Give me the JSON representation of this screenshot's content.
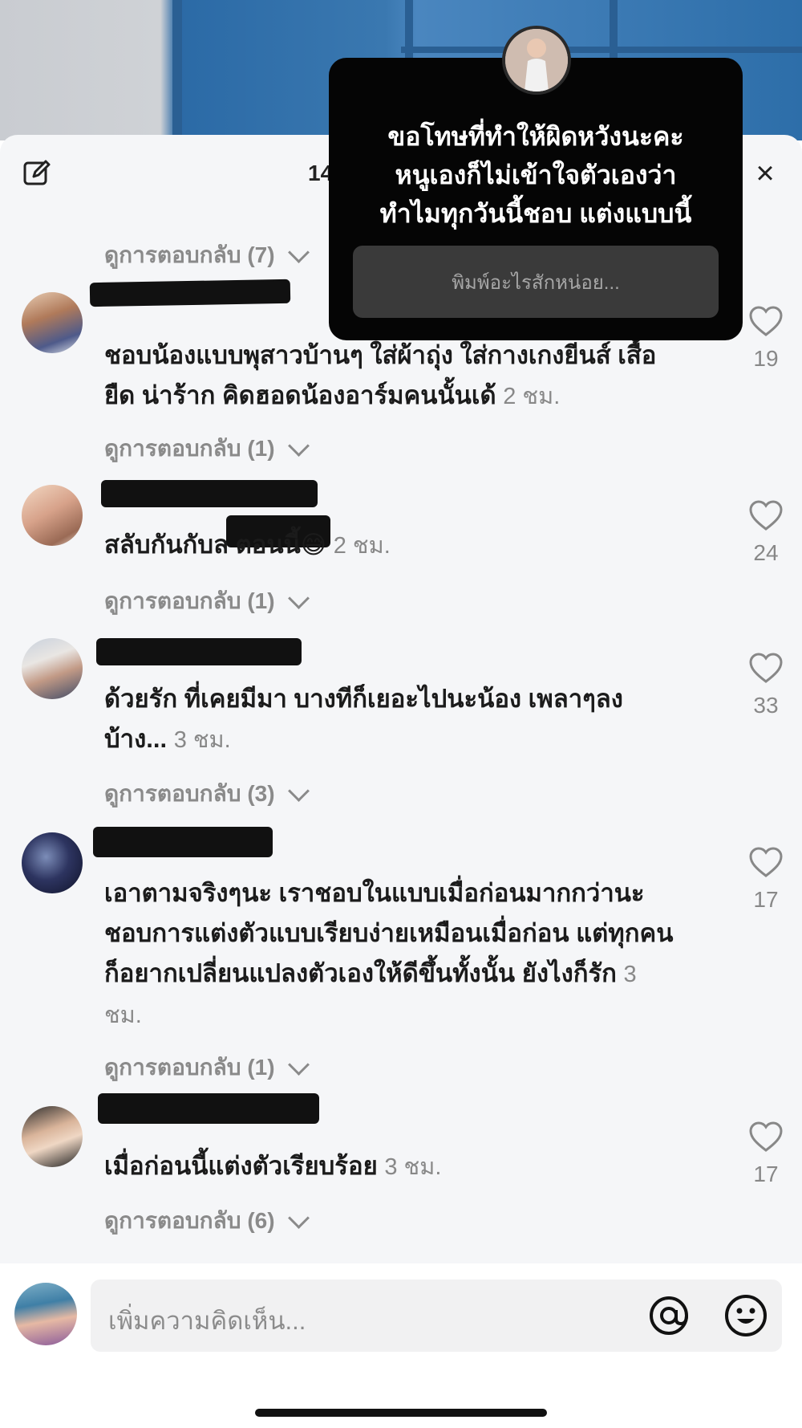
{
  "header": {
    "comment_count": "14"
  },
  "popup": {
    "lines": [
      "ขอโทษที่ทำให้ผิดหวังนะคะ",
      "หนูเองก็ไม่เข้าใจตัวเองว่า",
      "ทำไมทุกวันนี้ชอบ แต่งแบบนี้"
    ],
    "input_placeholder": "พิมพ์อะไรสักหน่อย..."
  },
  "comments": [
    {
      "replies_label": "ดูการตอบกลับ (7)"
    },
    {
      "text": "ชอบน้องแบบพุสาวบ้านๆ ใส่ผ้าถุุ่ง ใส่กางเกงยีนส์ เสื้อยืด น่าร้าก คิดฮอดน้องอาร์มคนนั้นเด้",
      "time": "2 ชม.",
      "likes": "19",
      "replies_label": "ดูการตอบกลับ (1)"
    },
    {
      "text": "สลับกันกับล         ตอนนี้",
      "emoji": "😅",
      "time": "2 ชม.",
      "likes": "24",
      "replies_label": "ดูการตอบกลับ (1)"
    },
    {
      "text": "ด้วยรัก ที่เคยมีมา บางทีก็เยอะไปนะน้อง เพลาๆลง บ้าง...",
      "time": "3 ชม.",
      "likes": "33",
      "replies_label": "ดูการตอบกลับ (3)"
    },
    {
      "text": "เอาตามจริงๆนะ เราชอบในแบบเมื่อก่อนมากกว่านะ ชอบการแต่งตัวแบบเรียบง่ายเหมือนเมื่อก่อน แต่ทุกคนก็อยากเปลี่ยนแปลงตัวเองให้ดีขึ้นทั้งนั้น ยังไงก็รัก",
      "time": "3 ชม.",
      "likes": "17",
      "replies_label": "ดูการตอบกลับ (1)"
    },
    {
      "text": "เมื่อก่อนนี้แต่งตัวเรียบร้อย",
      "time": "3 ชม.",
      "likes": "17",
      "replies_label": "ดูการตอบกลับ (6)"
    }
  ],
  "composer": {
    "placeholder": "เพิ่มความคิดเห็น..."
  },
  "colors": {
    "sheet_bg": "#f5f6f8",
    "popup_bg": "#050505",
    "muted": "#888888"
  }
}
